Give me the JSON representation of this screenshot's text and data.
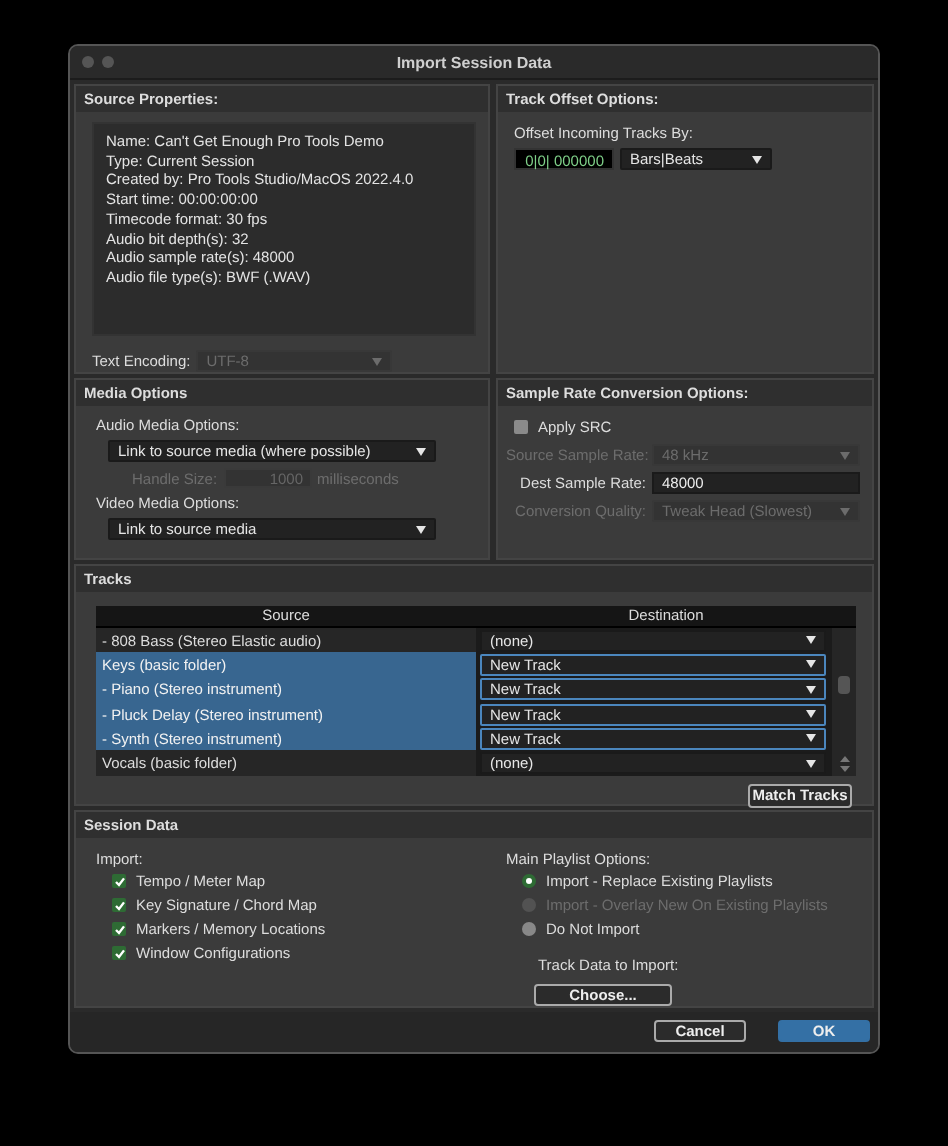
{
  "window": {
    "title": "Import Session Data"
  },
  "source_properties": {
    "title": "Source Properties:",
    "lines": [
      "Name: Can't Get Enough Pro Tools Demo",
      "Type: Current Session",
      "Created by: Pro Tools Studio/MacOS 2022.4.0",
      "Start time: 00:00:00:00",
      "Timecode format: 30 fps",
      "Audio bit depth(s): 32",
      "Audio sample rate(s): 48000",
      "Audio file type(s): BWF (.WAV)"
    ],
    "text_encoding": {
      "label": "Text Encoding:",
      "value": "UTF-8",
      "disabled": true
    }
  },
  "track_offset": {
    "title": "Track Offset Options:",
    "label": "Offset Incoming Tracks By:",
    "value": "0|0| 000000",
    "unit": "Bars|Beats"
  },
  "media_options": {
    "title": "Media Options",
    "audio_label": "Audio Media Options:",
    "audio_value": "Link to source media (where possible)",
    "handle": {
      "label": "Handle Size:",
      "value": "1000",
      "unit": "milliseconds",
      "disabled": true
    },
    "video_label": "Video Media Options:",
    "video_value": "Link to source media"
  },
  "sample_rate": {
    "title": "Sample Rate Conversion Options:",
    "apply": {
      "label": "Apply SRC",
      "checked": false
    },
    "fields": [
      {
        "label": "Source Sample Rate:",
        "value": "48 kHz",
        "kind": "select",
        "disabled": true
      },
      {
        "label": "Dest Sample Rate:",
        "value": "48000",
        "kind": "input",
        "disabled": false
      },
      {
        "label": "Conversion Quality:",
        "value": "Tweak Head (Slowest)",
        "kind": "select",
        "disabled": true
      }
    ]
  },
  "tracks": {
    "title": "Tracks",
    "columns": [
      "Source",
      "Destination"
    ],
    "rows": [
      {
        "source": "- 808 Bass (Stereo Elastic audio)",
        "destination": "(none)",
        "selected": false
      },
      {
        "source": "Keys (basic folder)",
        "destination": "New Track",
        "selected": true
      },
      {
        "source": "- Piano (Stereo instrument)",
        "destination": "New Track",
        "selected": true
      },
      {
        "source": "- Pluck Delay (Stereo instrument)",
        "destination": "New Track",
        "selected": true
      },
      {
        "source": "- Synth (Stereo instrument)",
        "destination": "New Track",
        "selected": true
      },
      {
        "source": "Vocals (basic folder)",
        "destination": "(none)",
        "selected": false
      }
    ],
    "match_button": "Match Tracks"
  },
  "session_data": {
    "title": "Session Data",
    "import_label": "Import:",
    "items": [
      {
        "label": "Tempo / Meter Map",
        "checked": true
      },
      {
        "label": "Key Signature / Chord Map",
        "checked": true
      },
      {
        "label": "Markers / Memory Locations",
        "checked": true
      },
      {
        "label": "Window Configurations",
        "checked": true
      }
    ],
    "playlist_label": "Main Playlist Options:",
    "playlist_options": [
      {
        "label": "Import - Replace Existing Playlists",
        "selected": true,
        "disabled": false
      },
      {
        "label": "Import - Overlay New On Existing Playlists",
        "selected": false,
        "disabled": true
      },
      {
        "label": "Do Not Import",
        "selected": false,
        "disabled": false
      }
    ],
    "track_data_label": "Track Data to Import:",
    "choose_button": "Choose..."
  },
  "buttons": [
    {
      "label": "Cancel",
      "kind": "secondary"
    },
    {
      "label": "OK",
      "kind": "default"
    }
  ]
}
